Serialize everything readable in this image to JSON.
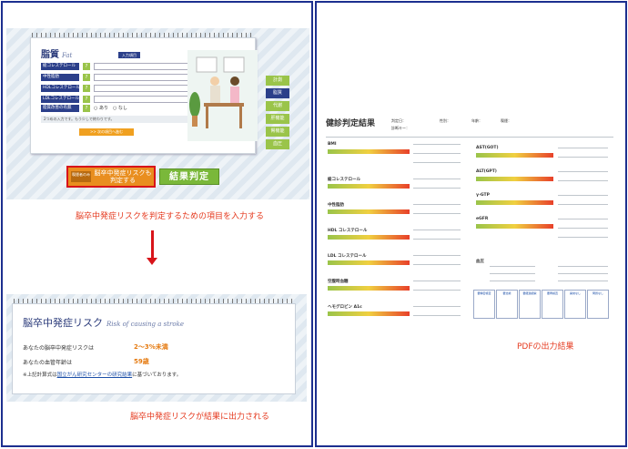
{
  "form": {
    "title": "脂質",
    "title_en": "Fat",
    "input_button": "入力項目",
    "rows": [
      {
        "label": "総コレステロール",
        "unit": "mg/dl"
      },
      {
        "label": "中性脂肪",
        "unit": "mg/dl"
      },
      {
        "label": "HDLコレステロール",
        "unit": "mg/dl"
      },
      {
        "label": "LDLコレステロール",
        "unit": "mg/dl"
      },
      {
        "label": "脂質改善の有無",
        "unit": ""
      }
    ],
    "radio_yes": "あり",
    "radio_no": "なし",
    "note": "2つめの入力です。もう少しで終わりです。",
    "next_button": ">> 次の項目へ進む",
    "side_tabs": [
      "計測",
      "脂質",
      "代謝",
      "肝機能",
      "腎機能",
      "血圧"
    ],
    "active_tab": 1,
    "stroke_button_small": "喫煙者のみ",
    "stroke_button_main": "脳卒中発症リスクも判定する",
    "judge_button": "結果判定"
  },
  "caption_input": "脳卒中発症リスクを判定するための項目を入力する",
  "caption_output": "脳卒中発症リスクが結果に出力される",
  "caption_pdf": "PDFの出力結果",
  "result": {
    "title": "脳卒中発症リスク",
    "title_en": "Risk of causing a stroke",
    "risk_label": "あなたの脳卒中発症リスクは",
    "risk_value": "2～3%未満",
    "age_label": "あなたの血管年齢は",
    "age_value": "59歳",
    "note_prefix": "※上記計算式は",
    "note_link": "国立がん研究センターの研究結果",
    "note_suffix": "に基づいております。"
  },
  "pdf": {
    "title": "健診判定結果",
    "meta": [
      "判定日：",
      "性別：",
      "年齢：",
      "喫煙：",
      "診断キー："
    ],
    "left_sections": [
      "BMI",
      "総コレステロール",
      "中性脂肪",
      "HDL コレステロール",
      "LDL コレステロール",
      "空腹時血糖",
      "ヘモグロビン A1c"
    ],
    "right_sections": [
      "AST(GOT)",
      "ALT(GPT)",
      "γ-GTP",
      "eGFR",
      "血圧"
    ],
    "boxes": [
      "要精密検査",
      "要治療",
      "要経過観察",
      "要再検査",
      "異常なし",
      "問題なし"
    ]
  },
  "colors": {
    "accent": "#1c2f8f",
    "caption": "#e53a1f",
    "green": "#9ac44a",
    "orange": "#e98e1f"
  }
}
